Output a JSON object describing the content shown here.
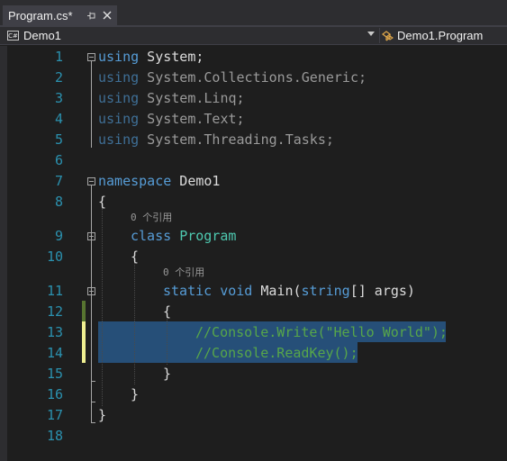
{
  "tab": {
    "title": "Program.cs*",
    "pin_glyph": "⊣",
    "close_glyph": "✕"
  },
  "navbar": {
    "project": "Demo1",
    "project_badge": "C#",
    "type": "Demo1.Program"
  },
  "hints": {
    "class_refs": "0 个引用",
    "method_refs": "0 个引用"
  },
  "lines": [
    {
      "n": "1"
    },
    {
      "n": "2"
    },
    {
      "n": "3"
    },
    {
      "n": "4"
    },
    {
      "n": "5"
    },
    {
      "n": "6"
    },
    {
      "n": "7"
    },
    {
      "n": "8"
    },
    {
      "n": "9"
    },
    {
      "n": "10"
    },
    {
      "n": "11"
    },
    {
      "n": "12"
    },
    {
      "n": "13"
    },
    {
      "n": "14"
    },
    {
      "n": "15"
    },
    {
      "n": "16"
    },
    {
      "n": "17"
    },
    {
      "n": "18"
    }
  ],
  "code": {
    "l1": {
      "kw": "using",
      "rest": " System;"
    },
    "l2": {
      "kw": "using",
      "rest": " System.Collections.Generic;"
    },
    "l3": {
      "kw": "using",
      "rest": " System.Linq;"
    },
    "l4": {
      "kw": "using",
      "rest": " System.Text;"
    },
    "l5": {
      "kw": "using",
      "rest": " System.Threading.Tasks;"
    },
    "l7": {
      "kw": "namespace",
      "rest": " Demo1"
    },
    "l8": "{",
    "l9": {
      "kw": "class",
      "name": "Program"
    },
    "l10": "{",
    "l11": {
      "kw1": "static",
      "kw2": "void",
      "name": "Main(",
      "kw3": "string",
      "rest": "[] args)"
    },
    "l12": "{",
    "l13": "//Console.Write(\"Hello World\");",
    "l14": "//Console.ReadKey();",
    "l15": "}",
    "l16": "}",
    "l17": "}"
  },
  "colors": {
    "background": "#1e1e1e",
    "line_number": "#2b91af",
    "keyword": "#569cd6",
    "type": "#4ec9b0",
    "comment": "#57a64a",
    "selection": "#264f78",
    "saved_change": "#577430",
    "unsaved_change": "#efef91"
  }
}
